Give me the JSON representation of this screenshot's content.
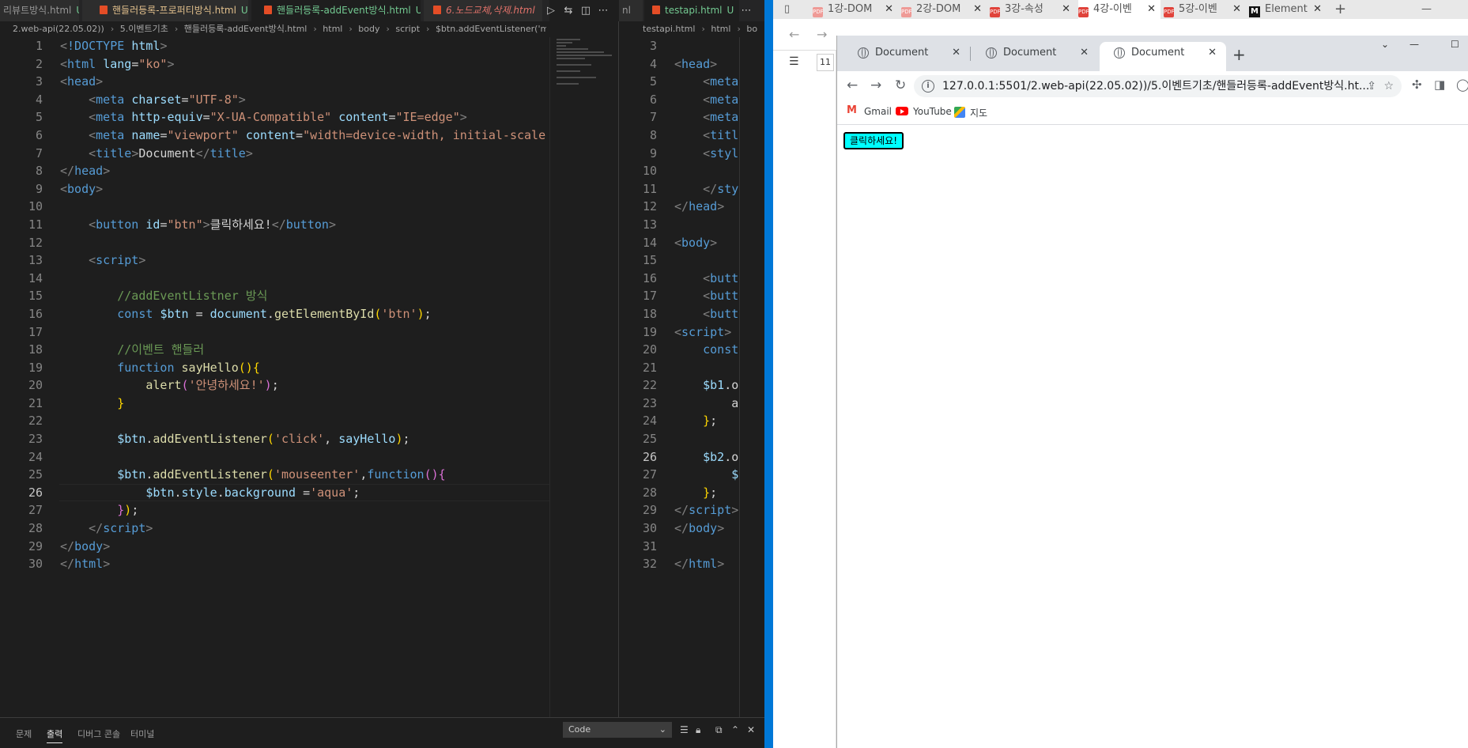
{
  "vscode": {
    "left_tabs": [
      {
        "label": "리뷰트방식.html",
        "status": "U",
        "active": false
      },
      {
        "label": "핸들러등록-프로퍼티방식.html",
        "status": "U",
        "active": false
      },
      {
        "label": "핸들러등록-addEvent방식.html",
        "status": "U",
        "active": true
      },
      {
        "label": "6.노드교체,삭제.html",
        "status": "",
        "active": false
      }
    ],
    "right_tabs": [
      {
        "label": "nl"
      },
      {
        "label": "testapi.html",
        "status": "U"
      }
    ],
    "breadcrumb_left": [
      "2.web-api(22.05.02))",
      "5.이벤트기초",
      "핸들러등록-addEvent방식.html",
      "html",
      "body",
      "script",
      "$btn.addEventListener('mouseenter') callback"
    ],
    "breadcrumb_right": [
      "testapi.html",
      "html",
      "bo"
    ],
    "current_line": "26",
    "panel": {
      "tabs": [
        "문제",
        "출력",
        "디버그 콘솔",
        "터미널"
      ],
      "active_tab": "출력",
      "select_value": "Code"
    }
  },
  "background_browser": {
    "tabs": [
      "1강-DOM",
      "2강-DOM",
      "3강-속성",
      "4강-이벤",
      "5강-이벤",
      "Element"
    ],
    "active_tab": "4강-이벤"
  },
  "chrome": {
    "tabs": [
      "Document",
      "Document",
      "Document"
    ],
    "active_tab_index": 2,
    "url": "127.0.0.1:5501/2.web-api(22.05.02))/5.이벤트기초/핸들러등록-addEvent방식.ht...",
    "bookmarks": [
      "Gmail",
      "YouTube",
      "지도"
    ],
    "page_button_label": "클릭하세요!",
    "page_button_color": "#00ffff"
  },
  "colors": {
    "editor_bg": "#1e1e1e",
    "windows_accent": "#0078d7",
    "chrome_tabstrip": "#dee1e6"
  }
}
